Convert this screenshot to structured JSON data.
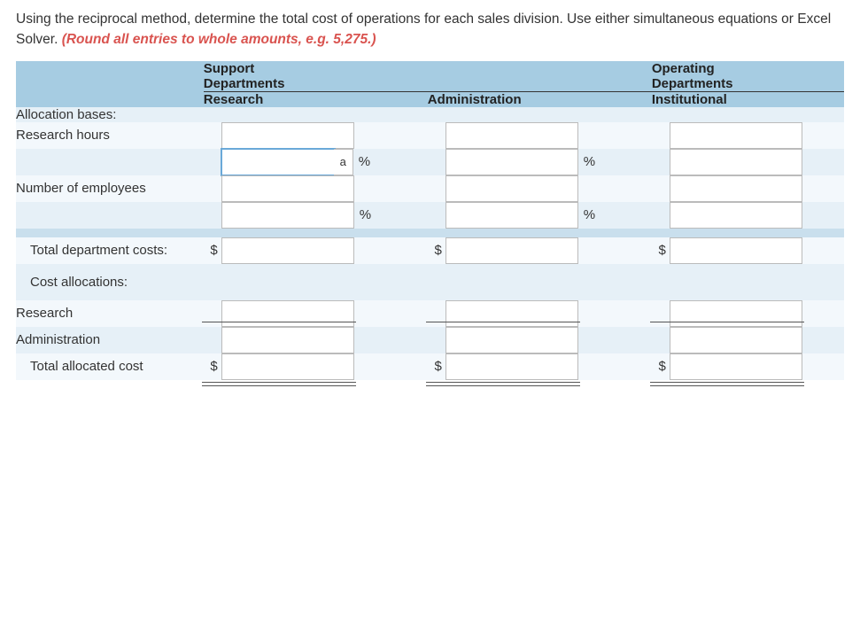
{
  "question": {
    "text1": "Using the reciprocal method, determine the total cost of operations for each sales division. Use either simultaneous equations or Excel Solver. ",
    "text2": "(Round all entries to whole amounts, e.g. 5,275.)"
  },
  "headers": {
    "support": "Support",
    "support_dept": "Departments",
    "operating": "Operating",
    "operating_dept": "Departments",
    "col_research": "Research",
    "col_admin": "Administration",
    "col_inst": "Institutional"
  },
  "rows": {
    "alloc_bases": "Allocation bases:",
    "research_hours": "Research hours",
    "num_employees": "Number of employees",
    "total_dept_costs": "Total department costs:",
    "cost_alloc": "Cost allocations:",
    "research": "Research",
    "administration": "Administration",
    "total_allocated": "Total allocated cost"
  },
  "symbols": {
    "dollar": "$",
    "percent": "%",
    "marker_a": "a"
  }
}
